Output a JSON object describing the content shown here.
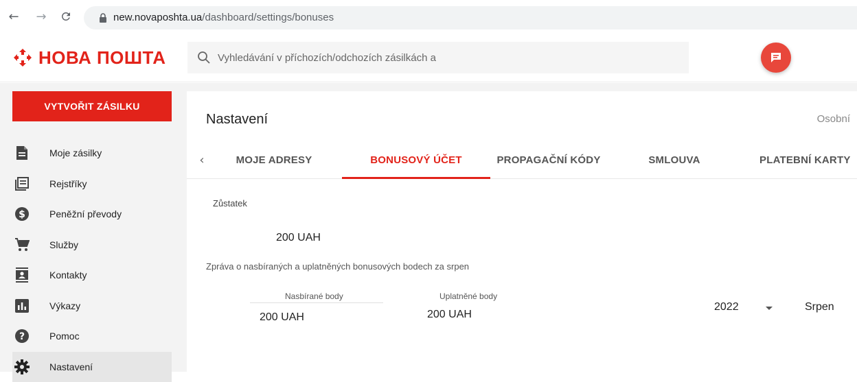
{
  "browser": {
    "url_host": "new.novaposhta.ua",
    "url_path": "/dashboard/settings/bonuses"
  },
  "header": {
    "logo_text": "НОВА ПОШТА",
    "search_placeholder": "Vyhledávání v příchozích/odchozích zásilkách a"
  },
  "sidebar": {
    "create_label": "VYTVOŘIT ZÁSILKU",
    "items": [
      {
        "label": "Moje zásilky",
        "icon": "document-icon"
      },
      {
        "label": "Rejstříky",
        "icon": "registry-icon"
      },
      {
        "label": "Peněžní převody",
        "icon": "dollar-icon"
      },
      {
        "label": "Služby",
        "icon": "cart-icon"
      },
      {
        "label": "Kontakty",
        "icon": "contacts-icon"
      },
      {
        "label": "Výkazy",
        "icon": "bar-chart-icon"
      },
      {
        "label": "Pomoc",
        "icon": "help-icon"
      },
      {
        "label": "Nastavení",
        "icon": "gear-icon"
      }
    ],
    "active_item": "Nastavení"
  },
  "main": {
    "title": "Nastavení",
    "right_link": "Osobní",
    "tabs": [
      {
        "label": "MOJE ADRESY"
      },
      {
        "label": "BONUSOVÝ ÚČET"
      },
      {
        "label": "PROPAGAČNÍ KÓDY"
      },
      {
        "label": "SMLOUVA"
      },
      {
        "label": "PLATEBNÍ KARTY"
      }
    ],
    "active_tab": "BONUSOVÝ ÚČET",
    "balance_label": "Zůstatek",
    "balance_value": "200 UAH",
    "report_text": "Zpráva o nasbíraných a uplatněných bonusových bodech za srpen",
    "collected_label": "Nasbírané body",
    "collected_value": "200 UAH",
    "used_label": "Uplatněné body",
    "used_value": "200 UAH",
    "year": "2022",
    "month": "Srpen"
  },
  "colors": {
    "brand_red": "#e2231a",
    "chat_red": "#e8473b"
  }
}
